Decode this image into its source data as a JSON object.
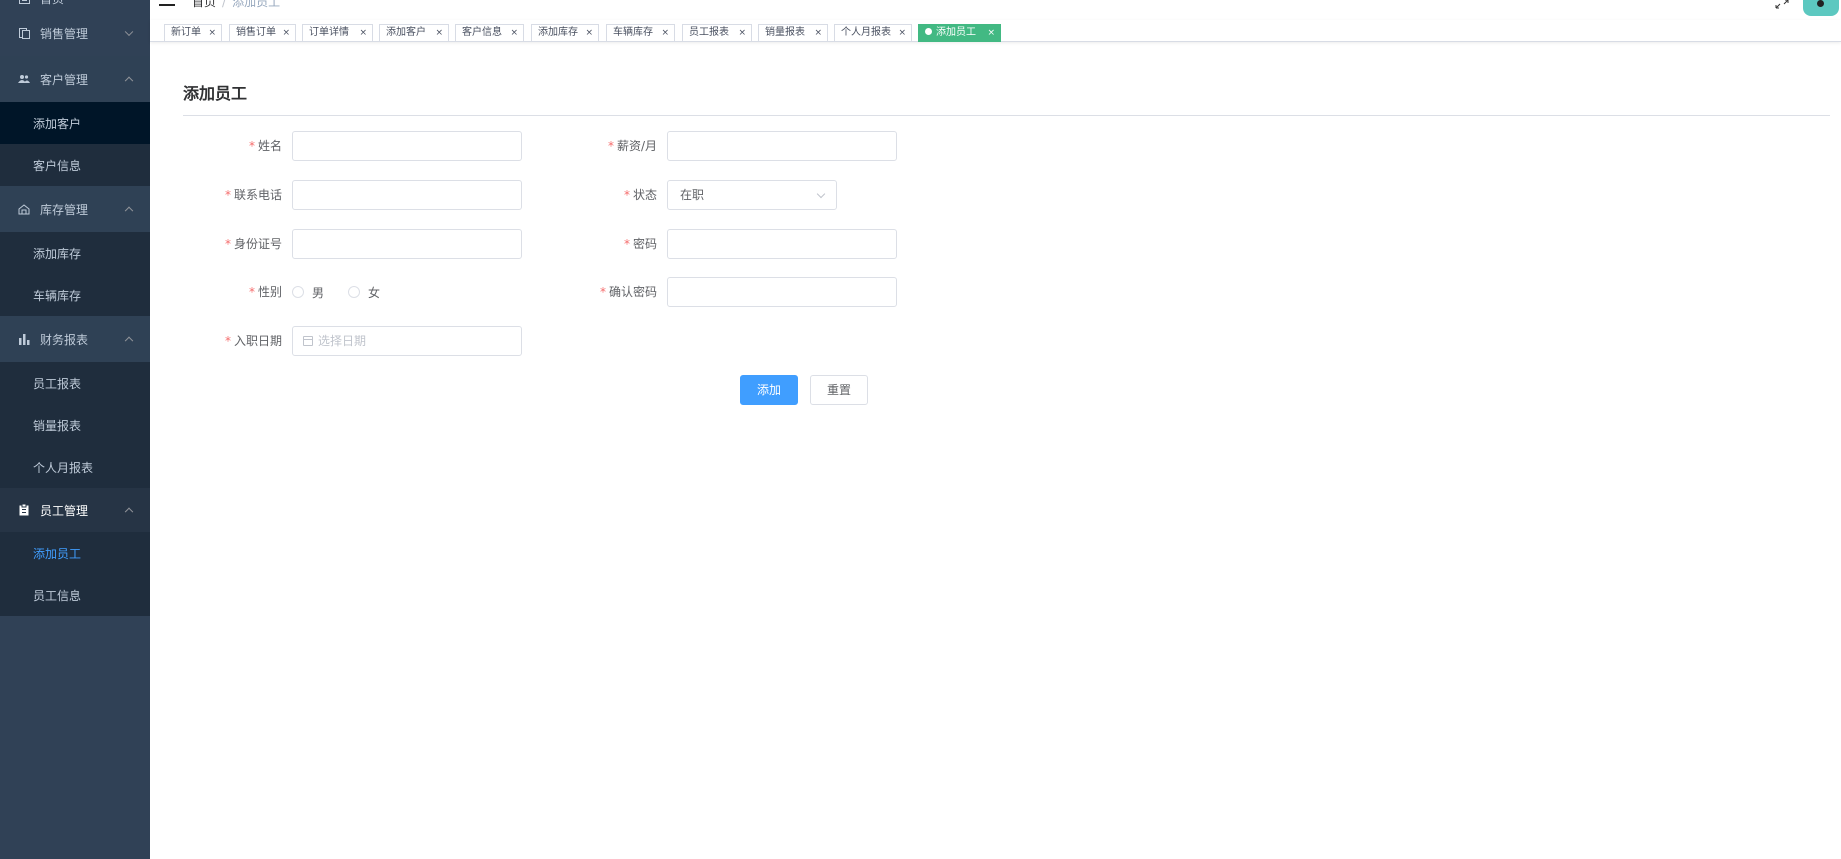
{
  "sidebar": {
    "home": "首页",
    "sales": "销售管理",
    "customers": {
      "label": "客户管理",
      "items": [
        "添加客户",
        "客户信息"
      ]
    },
    "inventory": {
      "label": "库存管理",
      "items": [
        "添加库存",
        "车辆库存"
      ]
    },
    "finance": {
      "label": "财务报表",
      "items": [
        "员工报表",
        "销量报表",
        "个人月报表"
      ]
    },
    "employees": {
      "label": "员工管理",
      "items": [
        "添加员工",
        "员工信息"
      ]
    }
  },
  "breadcrumb": {
    "root": "首页",
    "sep": "/",
    "current": "添加员工"
  },
  "tags": [
    "新订单",
    "销售订单",
    "订单详情",
    "添加客户",
    "客户信息",
    "添加库存",
    "车辆库存",
    "员工报表",
    "销量报表",
    "个人月报表",
    "添加员工"
  ],
  "tag_close": "×",
  "page": {
    "title": "添加员工"
  },
  "form": {
    "required_mark": "*",
    "name_label": "姓名",
    "salary_label": "薪资/月",
    "phone_label": "联系电话",
    "status_label": "状态",
    "status_value": "在职",
    "idcard_label": "身份证号",
    "password_label": "密码",
    "gender_label": "性别",
    "gender_male": "男",
    "gender_female": "女",
    "confirm_label": "确认密码",
    "hire_date_label": "入职日期",
    "hire_date_placeholder": "选择日期",
    "submit": "添加",
    "reset": "重置"
  },
  "colors": {
    "sidebar_bg": "#304156",
    "active_tag": "#42b983",
    "primary": "#409eff",
    "required": "#f56c6c"
  }
}
